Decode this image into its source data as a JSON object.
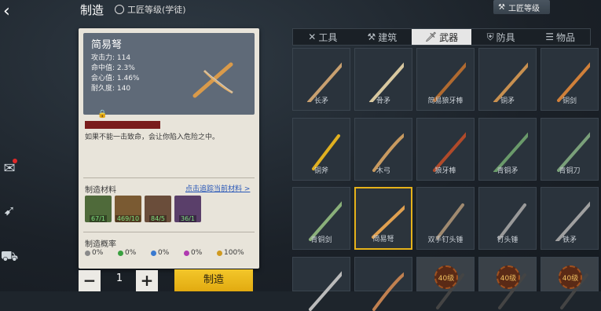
{
  "header": {
    "title": "制造",
    "rank_label": "工匠等级(学徒)",
    "rank_button": "工匠等级"
  },
  "item": {
    "name": "简易弩",
    "stats": [
      "攻击力: 114",
      "命中值: 2.3%",
      "会心值: 1.46%",
      "耐久度: 140"
    ],
    "description": "如果不能一击致命，会让你陷入危险之中。"
  },
  "materials": {
    "title": "制造材料",
    "track_link": "点击追踪当前材料 >",
    "items": [
      {
        "icon": "herb-icon",
        "count": "67/1",
        "color": "#4f6a3a"
      },
      {
        "icon": "wood-icon",
        "count": "469/10",
        "color": "#7a5a32"
      },
      {
        "icon": "tool-icon",
        "count": "84/5",
        "color": "#6a4d3a"
      },
      {
        "icon": "crystal-icon",
        "count": "36/1",
        "color": "#5a3f6a"
      }
    ]
  },
  "probability": {
    "title": "制造概率",
    "items": [
      {
        "value": "0%",
        "color": "#8a8a8a"
      },
      {
        "value": "0%",
        "color": "#3aa040"
      },
      {
        "value": "0%",
        "color": "#3a7ad0"
      },
      {
        "value": "0%",
        "color": "#b03ab0"
      },
      {
        "value": "100%",
        "color": "#d09a20"
      }
    ]
  },
  "controls": {
    "minus": "−",
    "plus": "+",
    "quantity": "1",
    "make_button": "制造"
  },
  "tabs": [
    {
      "label": "工具",
      "icon": "tools-icon"
    },
    {
      "label": "建筑",
      "icon": "hammer-icon"
    },
    {
      "label": "武器",
      "icon": "sword-icon",
      "active": true
    },
    {
      "label": "防具",
      "icon": "armor-icon"
    },
    {
      "label": "物品",
      "icon": "list-icon"
    }
  ],
  "grid": [
    {
      "label": "长矛"
    },
    {
      "label": "骨矛"
    },
    {
      "label": "简易狼牙棒"
    },
    {
      "label": "铜矛"
    },
    {
      "label": "铜剑"
    },
    {
      "label": "铜斧"
    },
    {
      "label": "木弓"
    },
    {
      "label": "狼牙棒"
    },
    {
      "label": "青铜矛"
    },
    {
      "label": "青铜刀"
    },
    {
      "label": "青铜剑"
    },
    {
      "label": "简易弩"
    },
    {
      "label": "双手钉头锤"
    },
    {
      "label": "钉头锤"
    },
    {
      "label": "铁矛"
    },
    {
      "label": ""
    },
    {
      "label": ""
    },
    {
      "label": ""
    },
    {
      "label": ""
    },
    {
      "label": ""
    }
  ],
  "locked_badge": "40级"
}
